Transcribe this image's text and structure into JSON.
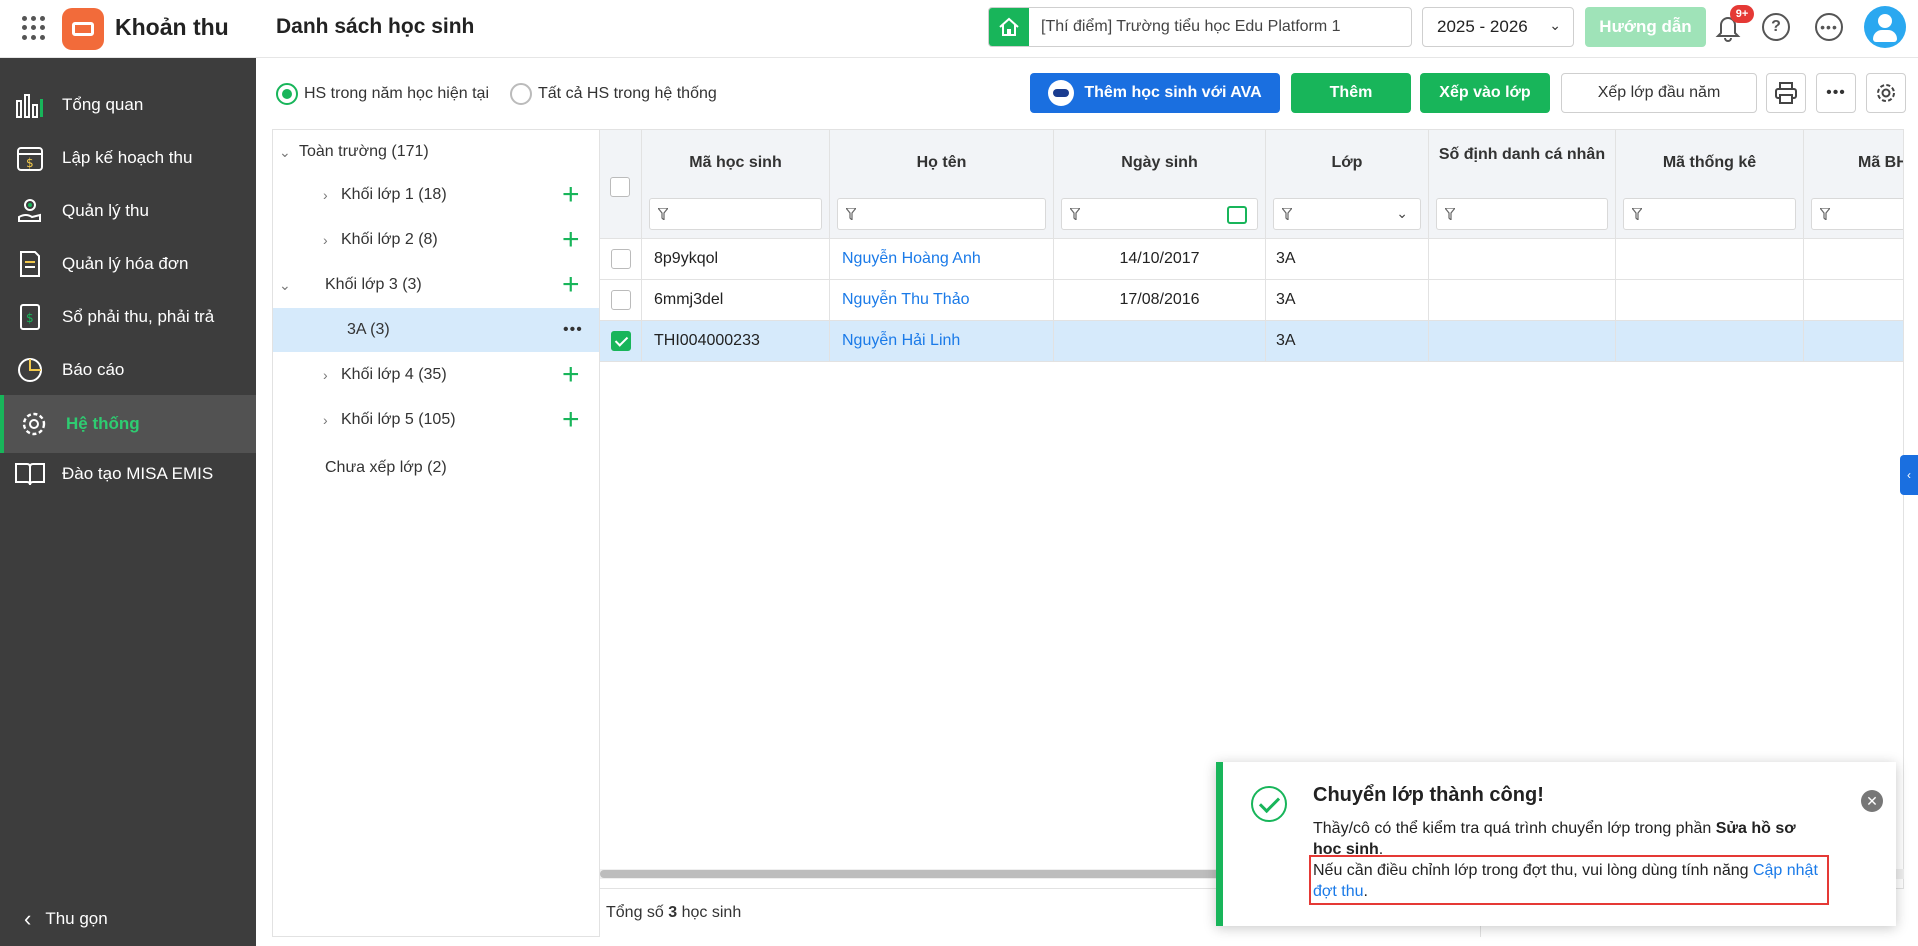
{
  "header": {
    "app_title": "Khoản thu",
    "page_title": "Danh sách học sinh",
    "school": "[Thí điểm] Trường tiểu học Edu Platform 1",
    "year": "2025 - 2026",
    "guide_label": "Hướng dẫn",
    "notification_badge": "9+"
  },
  "sidebar": {
    "items": [
      {
        "label": "Tổng quan",
        "icon": "chart-bar-icon"
      },
      {
        "label": "Lập kế hoạch thu",
        "icon": "calendar-money-icon"
      },
      {
        "label": "Quản lý thu",
        "icon": "hand-coin-icon"
      },
      {
        "label": "Quản lý hóa đơn",
        "icon": "invoice-icon"
      },
      {
        "label": "Sổ phải thu, phải trả",
        "icon": "ledger-icon"
      },
      {
        "label": "Báo cáo",
        "icon": "pie-chart-icon"
      },
      {
        "label": "Hệ thống",
        "icon": "gear-icon"
      },
      {
        "label": "Đào tạo MISA EMIS",
        "icon": "book-icon"
      }
    ],
    "active_index": 6,
    "collapse_label": "Thu gọn"
  },
  "filters": {
    "radio_current": "HS trong năm học hiện tại",
    "radio_all": "Tất cả HS trong hệ thống"
  },
  "toolbar": {
    "add_ava_label": "Thêm học sinh với AVA",
    "add_label": "Thêm",
    "assign_label": "Xếp vào lớp",
    "early_assign_label": "Xếp lớp đầu năm"
  },
  "tree": {
    "root": "Toàn trường (171)",
    "grade1": "Khối lớp 1  (18)",
    "grade2": "Khối lớp 2  (8)",
    "grade3": "Khối lớp 3  (3)",
    "class3a": "3A  (3)",
    "grade4": "Khối lớp 4  (35)",
    "grade5": "Khối lớp 5  (105)",
    "unassigned": "Chưa xếp lớp  (2)"
  },
  "table": {
    "columns": [
      "Mã học sinh",
      "Họ tên",
      "Ngày sinh",
      "Lớp",
      "Số định danh cá nhân",
      "Mã thống kê",
      "Mã BH"
    ],
    "rows": [
      {
        "code": "8p9ykqol",
        "name": "Nguyễn Hoàng Anh",
        "dob": "14/10/2017",
        "class": "3A",
        "checked": false
      },
      {
        "code": "6mmj3del",
        "name": "Nguyễn Thu Thảo",
        "dob": "17/08/2016",
        "class": "3A",
        "checked": false
      },
      {
        "code": "THI004000233",
        "name": "Nguyễn Hải Linh",
        "dob": "",
        "class": "3A",
        "checked": true
      }
    ],
    "total_prefix": "Tổng số",
    "total_count": "3",
    "total_suffix": "học sinh"
  },
  "toast": {
    "title": "Chuyển lớp thành công!",
    "line1_text": "Thầy/cô có thể kiểm tra quá trình chuyển lớp trong phần ",
    "line1_bold": "Sửa hồ sơ học sinh",
    "line1_end": ".",
    "line2_text": "Nếu cần điều chỉnh lớp trong đợt thu, vui lòng dùng tính năng ",
    "line2_link": "Cập nhật đợt thu",
    "line2_end": "."
  }
}
